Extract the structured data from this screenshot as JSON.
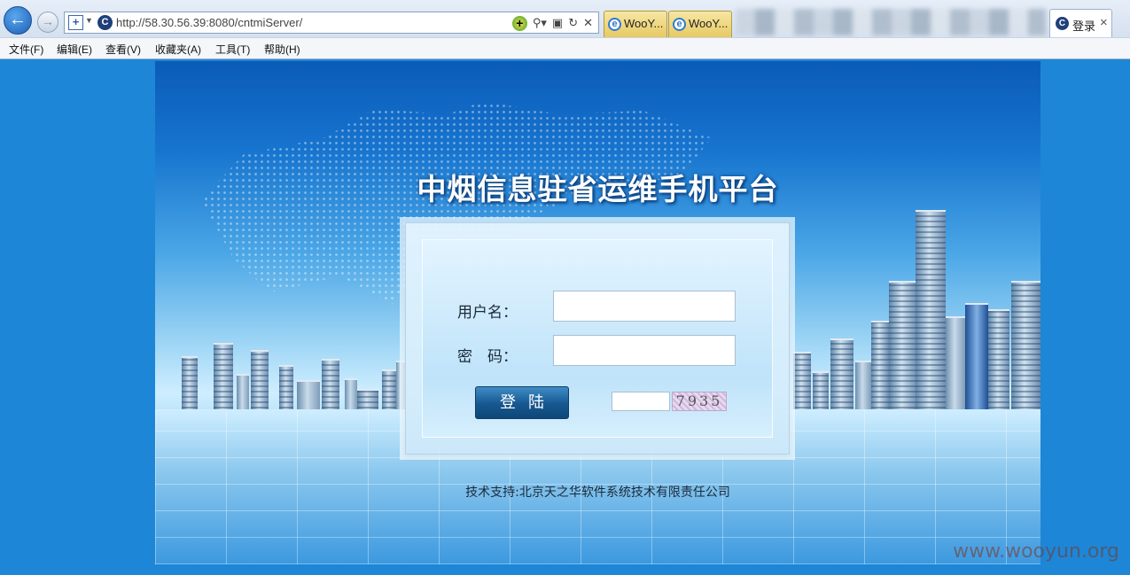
{
  "browser": {
    "url": "http://58.30.56.39:8080/cntmiServer/",
    "tabs": [
      {
        "label": "WooY..."
      },
      {
        "label": "WooY..."
      }
    ],
    "active_tab": {
      "label": "登录"
    },
    "menu": [
      "文件(F)",
      "编辑(E)",
      "查看(V)",
      "收藏夹(A)",
      "工具(T)",
      "帮助(H)"
    ]
  },
  "login": {
    "title": "中烟信息驻省运维手机平台",
    "username_label": "用户名：",
    "username_value": "",
    "password_label": "密　码：",
    "password_value": "",
    "login_button": "登陆",
    "captcha_value": "",
    "captcha_text": "7935",
    "support": "技术支持:北京天之华软件系统技术有限责任公司"
  },
  "watermark": "www.wooyun.org"
}
